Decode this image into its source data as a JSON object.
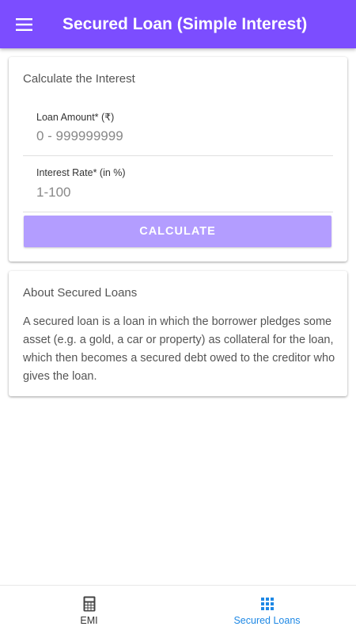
{
  "app_bar": {
    "title": "Secured Loan (Simple Interest)",
    "color": "#7c4dff",
    "menu_icon": "menu-icon"
  },
  "calculator": {
    "title": "Calculate the Interest",
    "loan_amount": {
      "label": "Loan Amount* (₹)",
      "placeholder": "0 - 999999999",
      "value": ""
    },
    "interest_rate": {
      "label": "Interest Rate* (in %)",
      "placeholder": "1-100",
      "value": ""
    },
    "calculate_label": "CALCULATE",
    "button_color": "#b39dff"
  },
  "about": {
    "title": "About Secured Loans",
    "text": "A secured loan is a loan in which the borrower pledges some asset (e.g. a gold, a car or property) as collateral for the loan, which then becomes a secured debt owed to the creditor who gives the loan."
  },
  "bottom_nav": {
    "items": [
      {
        "label": "EMI",
        "icon": "calculator-icon",
        "active": false
      },
      {
        "label": "Secured Loans",
        "icon": "grid-icon",
        "active": true
      }
    ],
    "active_color": "#1e88e5"
  }
}
